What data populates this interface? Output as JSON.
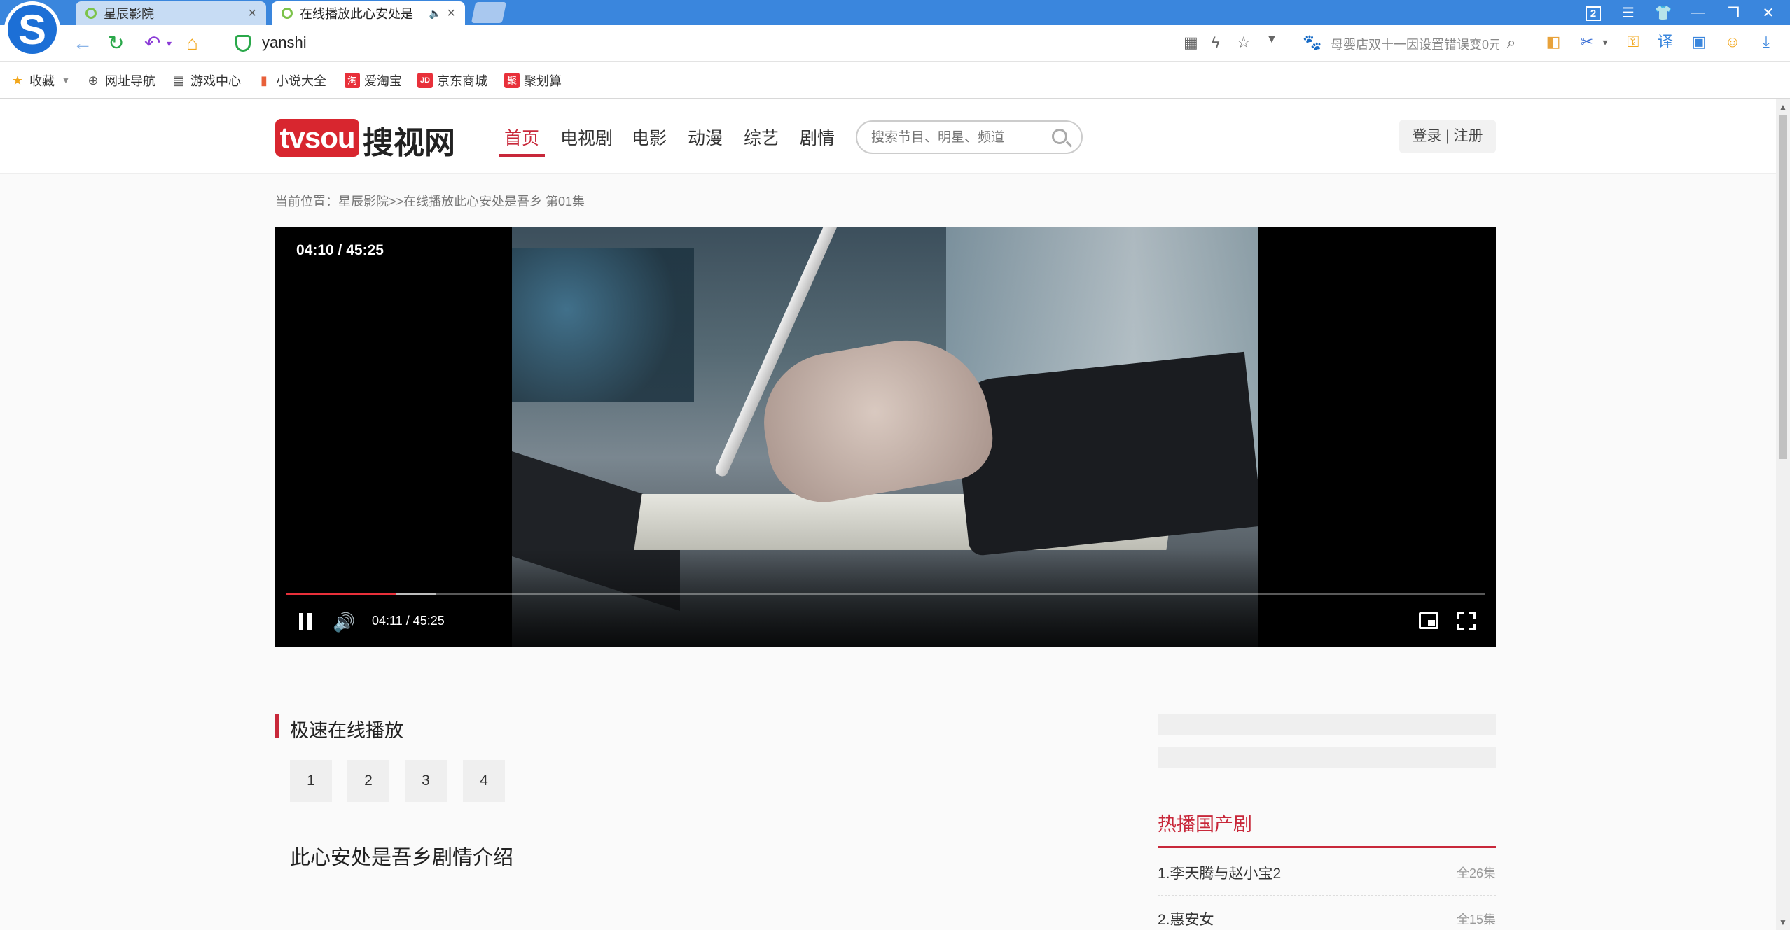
{
  "browser": {
    "logo_glyph": "S",
    "tabs": [
      {
        "title": "星辰影院"
      },
      {
        "title": "在线播放此心安处是"
      }
    ],
    "tab_close": "×",
    "speaker_glyph": "🔈",
    "url": "yanshi",
    "window_count": "2",
    "search_hint": "母婴店双十一因设置错误变0元",
    "bookmarks": [
      {
        "label": "收藏",
        "icon": "★"
      },
      {
        "label": "网址导航",
        "icon": "⊕"
      },
      {
        "label": "游戏中心",
        "icon": "▤"
      },
      {
        "label": "小说大全",
        "icon": "▮"
      },
      {
        "label": "爱淘宝",
        "icon": "淘"
      },
      {
        "label": "京东商城",
        "icon": "JD"
      },
      {
        "label": "聚划算",
        "icon": "聚"
      }
    ]
  },
  "site": {
    "logo_mark": "tvsou",
    "logo_text": "搜视网",
    "nav": [
      "首页",
      "电视剧",
      "电影",
      "动漫",
      "综艺",
      "剧情"
    ],
    "search_placeholder": "搜索节目、明星、频道",
    "login_label": "登录 | 注册"
  },
  "breadcrumb": {
    "prefix": "当前位置：",
    "site": "星辰影院",
    "sep": ">>",
    "current": "在线播放此心安处是吾乡 第01集"
  },
  "player": {
    "overlay_time": "04:10 / 45:25",
    "control_time": "04:11 / 45:25",
    "progress_played": 0.092,
    "progress_buffered": 0.125
  },
  "sources": {
    "title": "极速在线播放",
    "episodes": [
      "1",
      "2",
      "3",
      "4"
    ]
  },
  "plot": {
    "title": "此心安处是吾乡剧情介绍"
  },
  "hot": {
    "title": "热播国产剧",
    "items": [
      {
        "name": "1.李天腾与赵小宝2",
        "count": "全26集"
      },
      {
        "name": "2.惠安女",
        "count": "全15集"
      }
    ]
  },
  "colors": {
    "accent": "#c8283a",
    "tabbar": "#3a86dd"
  }
}
